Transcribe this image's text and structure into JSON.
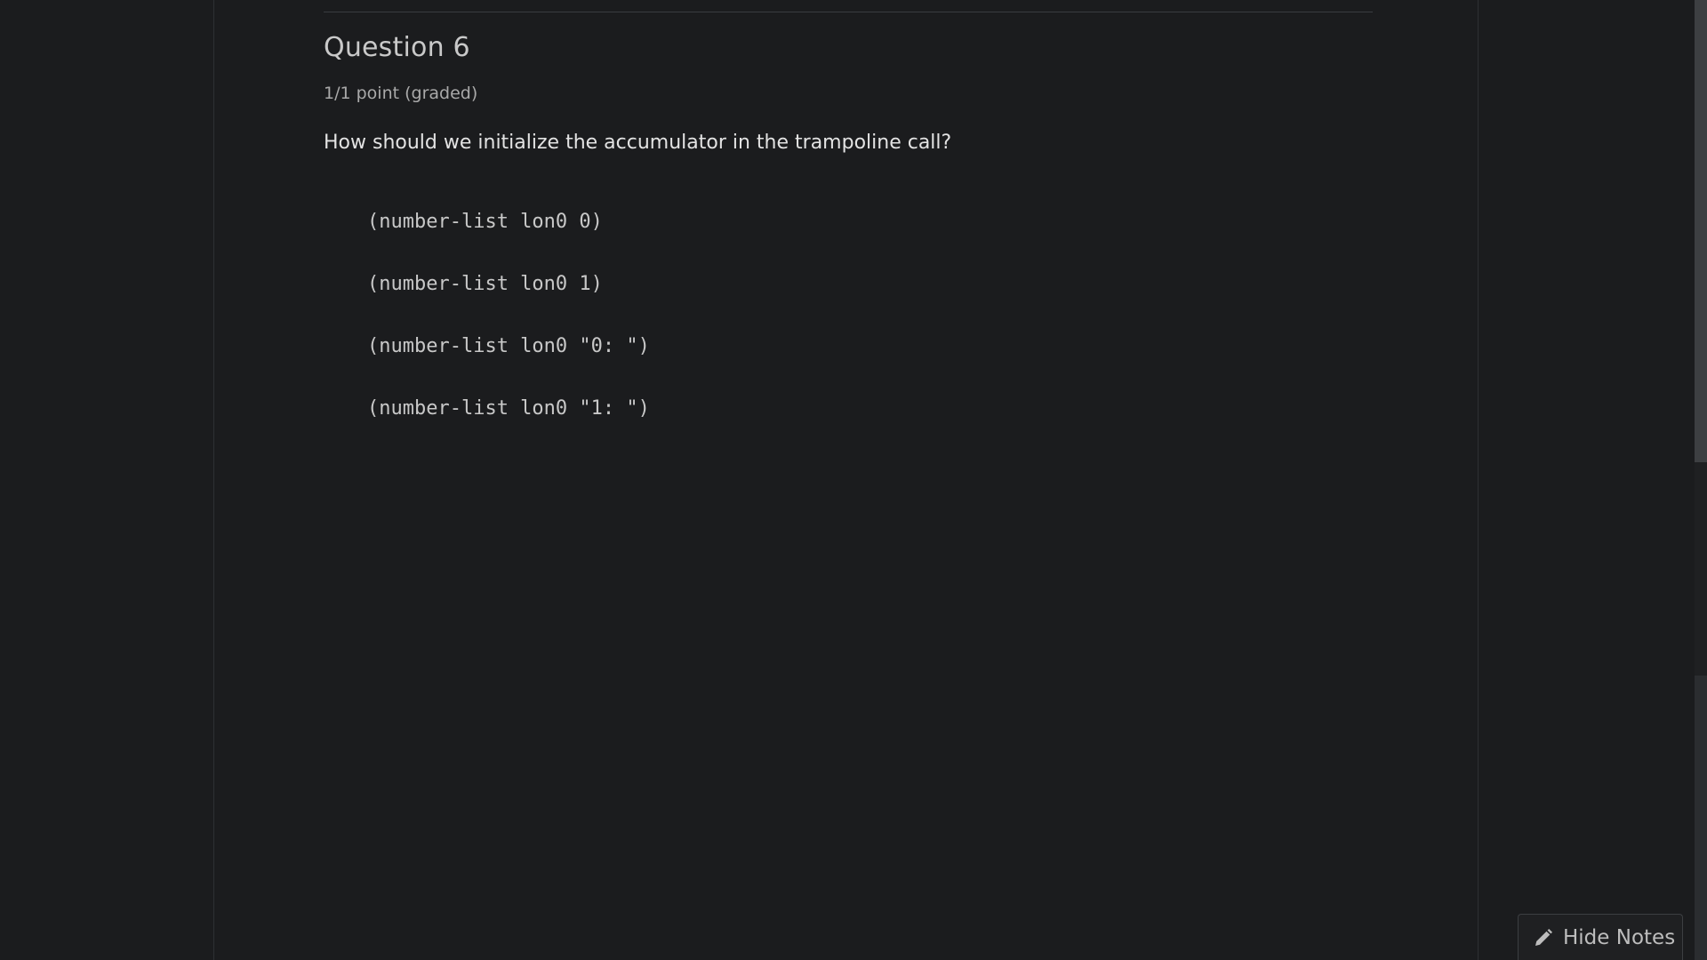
{
  "question": {
    "title": "Question 6",
    "points": "1/1 point (graded)",
    "prompt": "How should we initialize the accumulator in the trampoline call?",
    "options": [
      "(number-list lon0 0)",
      "(number-list lon0 1)",
      "(number-list lon0 \"0: \")",
      "(number-list lon0 \"1: \")"
    ]
  },
  "notes_button": {
    "label": "Hide Notes",
    "icon": "pencil-icon"
  },
  "colors": {
    "background": "#1b1c1e",
    "text_primary": "#e3e3e3",
    "text_muted": "#a9a9a9"
  }
}
